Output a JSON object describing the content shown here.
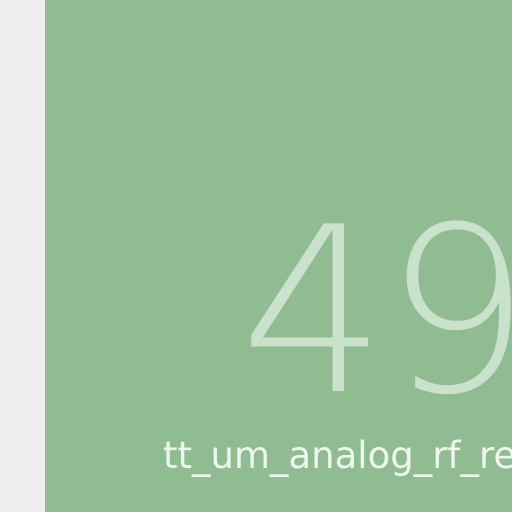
{
  "tile": {
    "number": "49",
    "label": "tt_um_analog_rf_rea",
    "background_color": "#8fbd91",
    "number_color": "#cae1cb",
    "label_color": "#eef6ee"
  },
  "page": {
    "background_color": "#eeeeee"
  }
}
